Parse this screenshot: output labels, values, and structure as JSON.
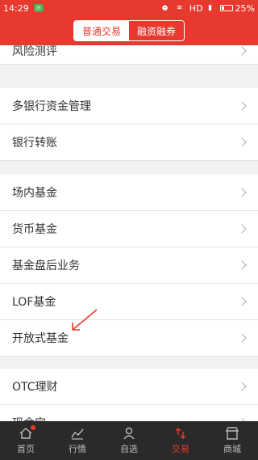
{
  "status_bar": {
    "time": "14:29",
    "network": "HD",
    "battery": "25%"
  },
  "header": {
    "tabs": [
      {
        "label": "普通交易"
      },
      {
        "label": "融资融券"
      }
    ]
  },
  "menu": {
    "items": [
      {
        "label": "风险测评"
      },
      {
        "label": "多银行资金管理"
      },
      {
        "label": "银行转账"
      },
      {
        "label": "场内基金"
      },
      {
        "label": "货币基金"
      },
      {
        "label": "基金盘后业务"
      },
      {
        "label": "LOF基金"
      },
      {
        "label": "开放式基金"
      },
      {
        "label": "OTC理财"
      },
      {
        "label": "现金宝"
      }
    ]
  },
  "tab_bar": {
    "items": [
      {
        "label": "首页",
        "icon": "home-icon"
      },
      {
        "label": "行情",
        "icon": "chart-icon"
      },
      {
        "label": "自选",
        "icon": "person-icon"
      },
      {
        "label": "交易",
        "icon": "trade-icon"
      },
      {
        "label": "商城",
        "icon": "shop-icon"
      }
    ],
    "active_index": 3
  },
  "colors": {
    "accent": "#e8392f",
    "tabbar_bg": "#2a2a2a"
  }
}
